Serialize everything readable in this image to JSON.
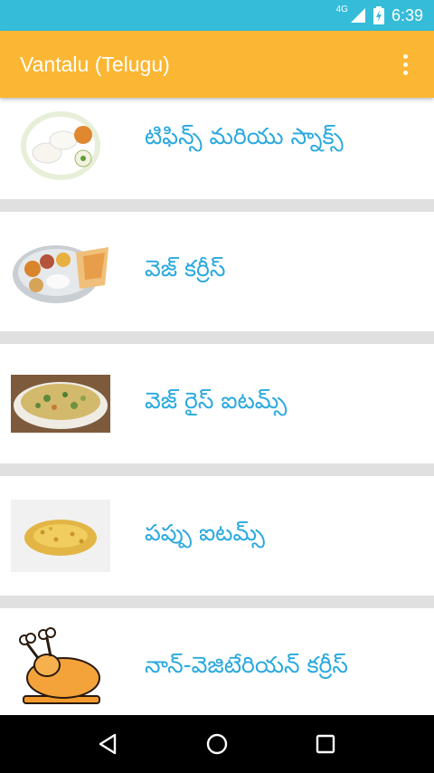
{
  "status": {
    "network": "4G",
    "time": "6:39"
  },
  "app": {
    "title": "Vantalu (Telugu)"
  },
  "categories": [
    {
      "label": "టిఫిన్స్ మరియు  స్నాక్స్",
      "icon": "idli-plate-icon"
    },
    {
      "label": "వెజ్ కర్రీస్",
      "icon": "veg-thali-icon"
    },
    {
      "label": "వెజ్ రైస్ ఐటమ్స్",
      "icon": "rice-dish-icon"
    },
    {
      "label": "పప్పు ఐటమ్స్",
      "icon": "dal-grains-icon"
    },
    {
      "label": "నాన్-వెజిటేరియన్ కర్రీస్",
      "icon": "roast-chicken-icon"
    }
  ],
  "colors": {
    "status_bar": "#35bcd9",
    "app_bar": "#fbb633",
    "label": "#29a9de"
  }
}
